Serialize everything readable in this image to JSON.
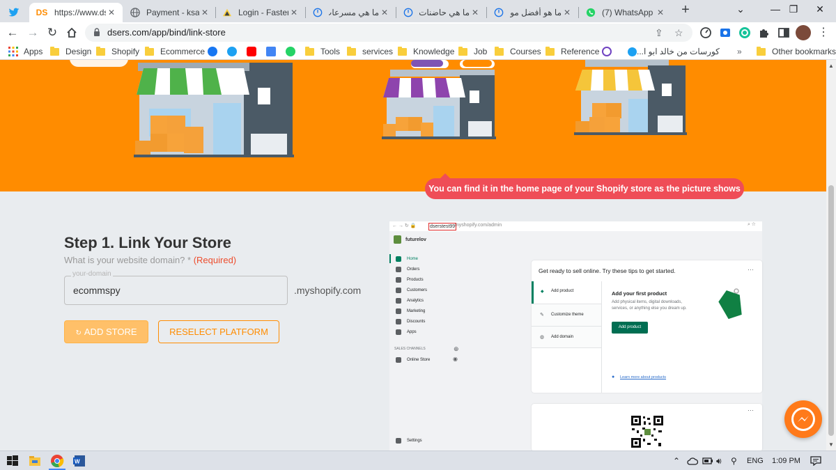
{
  "browser": {
    "tabs": [
      {
        "title": "",
        "favicon": "twitter-icon"
      },
      {
        "title": "https://www.dse",
        "favicon": "dsers-icon",
        "favicon_text": "DS",
        "active": true
      },
      {
        "title": "Payment - ksa4a",
        "favicon": "globe-icon"
      },
      {
        "title": "Login - FasterPa",
        "favicon": "fasterpay-icon"
      },
      {
        "title": "ما هي مسرعات ال",
        "favicon": "power-icon"
      },
      {
        "title": "ما هي حاضنات ال",
        "favicon": "power-icon"
      },
      {
        "title": "ما هو أفضل موقـ",
        "favicon": "power-icon"
      },
      {
        "title": "(7) WhatsApp",
        "favicon": "whatsapp-icon"
      }
    ],
    "address": "dsers.com/app/bind/link-store",
    "bookmarks": [
      {
        "label": "Apps",
        "icon": "apps-grid-icon"
      },
      {
        "label": "Design",
        "icon": "folder-icon"
      },
      {
        "label": "Shopify",
        "icon": "folder-icon"
      },
      {
        "label": "Ecommerce",
        "icon": "folder-icon"
      },
      {
        "label": "Tools",
        "icon": "folder-icon"
      },
      {
        "label": "services",
        "icon": "folder-icon"
      },
      {
        "label": "Knowledge",
        "icon": "folder-icon"
      },
      {
        "label": "Job",
        "icon": "folder-icon"
      },
      {
        "label": "Courses",
        "icon": "folder-icon"
      },
      {
        "label": "Reference",
        "icon": "folder-icon"
      },
      {
        "label": "كورسات من خالد ابو ا...",
        "icon": "twitter-icon"
      },
      {
        "label": "Other bookmarks",
        "icon": "folder-icon"
      }
    ]
  },
  "step": {
    "title": "Step 1. Link Your Store",
    "question": "What is your website domain? *",
    "required": "(Required)",
    "input_legend": "your-domain",
    "input_value": "ecommspy",
    "suffix": ".myshopify.com",
    "add_store_label": "ADD STORE",
    "reselect_label": "RESELECT PLATFORM"
  },
  "illustration": {
    "url_highlight": "dserstest99",
    "url_rest": ".myshopify.com/admin",
    "store_name": "futurelov",
    "callout": "You can find it in the home page of your Shopify store as the picture shows",
    "nav": [
      "Home",
      "Orders",
      "Products",
      "Customers",
      "Analytics",
      "Marketing",
      "Discounts",
      "Apps"
    ],
    "sales_channels": "SALES CHANNELS",
    "online_store": "Online Store",
    "settings": "Settings",
    "tips_heading": "Get ready to sell online. Try these tips to get started.",
    "tips": [
      "Add product",
      "Customize theme",
      "Add domain"
    ],
    "panel_title": "Add your first product",
    "panel_text_1": "Add physical items, digital downloads,",
    "panel_text_2": "services, or anything else you dream up.",
    "panel_button": "Add product",
    "learn_more": "Learn more about products",
    "more_dots": "···"
  },
  "taskbar": {
    "language": "ENG",
    "time": "1:09 PM"
  },
  "colors": {
    "brand_orange": "#ff8c00",
    "required_red": "#ed4d2d",
    "callout_red": "#ef4d57",
    "shopify_green": "#008060"
  }
}
